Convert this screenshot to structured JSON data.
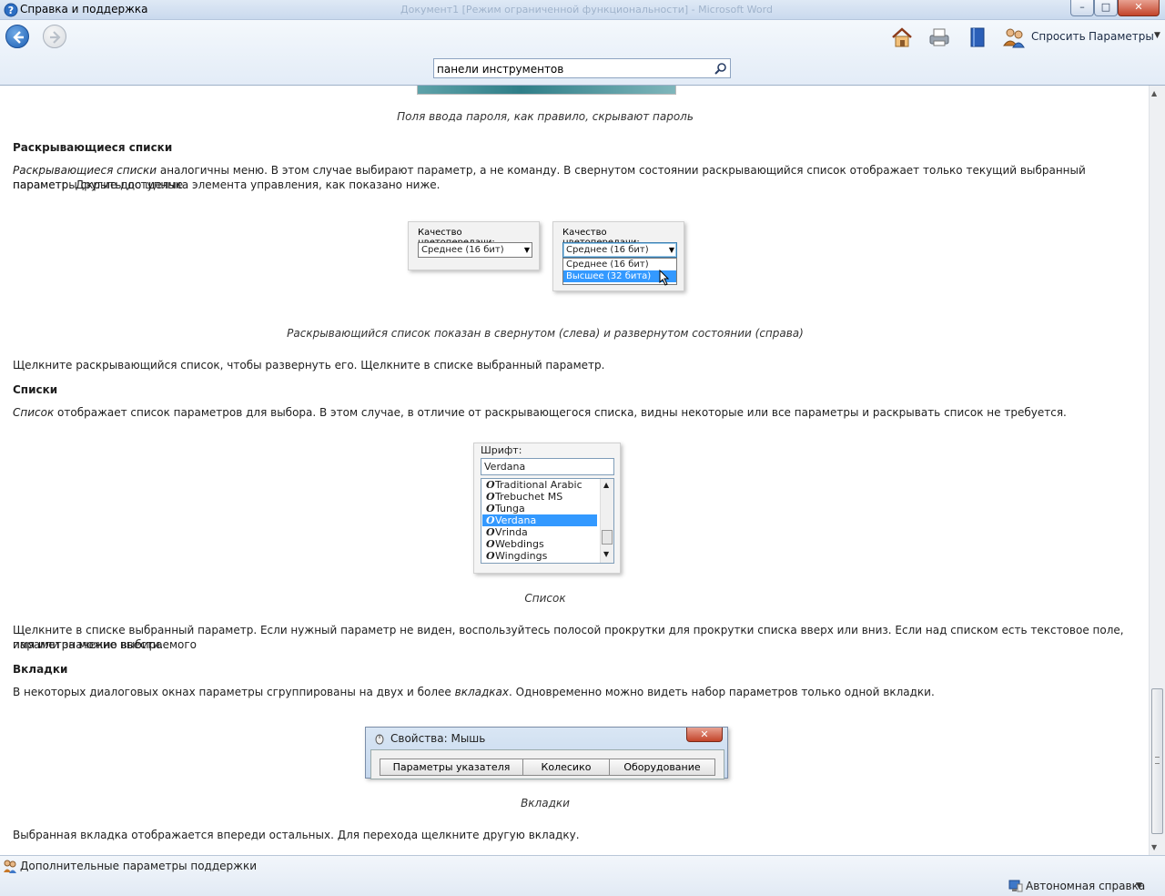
{
  "window": {
    "title": "Справка и поддержка",
    "background_title": "Документ1 [Режим ограниченной функциональности] - Microsoft Word",
    "minimize": "–",
    "maximize": "□",
    "close": "✕"
  },
  "toolbar": {
    "ask_label": "Спросить",
    "params_label": "Параметры",
    "icons": [
      "home-icon",
      "print-icon",
      "browse-help-icon",
      "ask-icon"
    ]
  },
  "search": {
    "value": "панели инструментов"
  },
  "content": {
    "caption_password": "Поля ввода пароля, как правило, скрывают пароль",
    "dropdowns": {
      "heading": "Раскрывающиеся списки",
      "para_italic": "Раскрывающиеся списки",
      "para_rest_1": " аналогичны меню. В этом случае выбирают параметр, а не команду. В свернутом состоянии раскрывающийся список отображает только текущий выбранный параметр. Другие доступные",
      "para_line_2": "параметры скрыты до щелчка элемента управления, как показано ниже.",
      "figure": {
        "label": "Качество цветопередачи:",
        "selected": "Среднее (16 бит)",
        "options": [
          "Среднее (16 бит)",
          "Высшее (32 бита)"
        ]
      },
      "caption": "Раскрывающийся список показан в свернутом (слева) и развернутом состоянии (справа)",
      "instruction": "Щелкните раскрывающийся список, чтобы развернуть его. Щелкните в списке выбранный параметр."
    },
    "lists": {
      "heading": "Списки",
      "para_italic": "Список",
      "para_rest": " отображает список параметров для выбора. В этом случае, в отличие от раскрывающегося списка, видны некоторые или все параметры и раскрывать список не требуется.",
      "figure": {
        "label": "Шрифт:",
        "value": "Verdana",
        "items": [
          "Traditional Arabic",
          "Trebuchet MS",
          "Tunga",
          "Verdana",
          "Vrinda",
          "Webdings",
          "Wingdings"
        ],
        "selected_index": 3
      },
      "caption": "Список",
      "instruction_1": "Щелкните в списке выбранный параметр. Если нужный параметр не виден, воспользуйтесь полосой прокрутки для прокрутки списка вверх или вниз. Если над списком есть текстовое поле, имя или значение выбираемого",
      "instruction_2": "параметра можно ввести."
    },
    "tabs": {
      "heading": "Вкладки",
      "para_start": "В некоторых диалоговых окнах параметры сгруппированы на двух и более ",
      "para_italic": "вкладках",
      "para_end": ". Одновременно можно видеть набор параметров только одной вкладки.",
      "figure": {
        "title": "Свойства: Мышь",
        "tabs": [
          "Параметры указателя",
          "Колесико",
          "Оборудование"
        ]
      },
      "caption": "Вкладки",
      "instruction": "Выбранная вкладка отображается впереди остальных. Для перехода щелкните другую вкладку."
    }
  },
  "statusbar": {
    "support_link": "Дополнительные параметры поддержки",
    "offline_label": "Автономная справка"
  }
}
